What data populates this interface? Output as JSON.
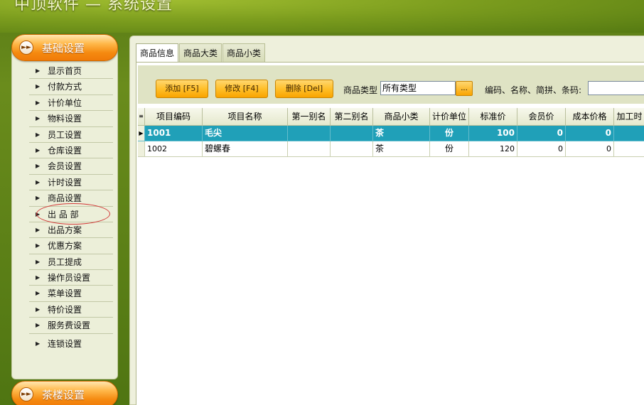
{
  "window": {
    "title": "中顶软件 — 系统设置"
  },
  "sidebar": {
    "group1": {
      "label": "基础设置"
    },
    "items": [
      {
        "label": "显示首页"
      },
      {
        "label": "付款方式"
      },
      {
        "label": "计价单位"
      },
      {
        "label": "物料设置"
      },
      {
        "label": "员工设置"
      },
      {
        "label": "仓库设置"
      },
      {
        "label": "会员设置"
      },
      {
        "label": "计时设置"
      },
      {
        "label": "商品设置"
      },
      {
        "label": "出 品 部"
      },
      {
        "label": "出品方案"
      },
      {
        "label": "优惠方案"
      },
      {
        "label": "员工提成"
      },
      {
        "label": "操作员设置"
      },
      {
        "label": "菜单设置"
      },
      {
        "label": "特价设置"
      },
      {
        "label": "服务费设置"
      },
      {
        "label": "连锁设置"
      }
    ],
    "group2": {
      "label": "茶楼设置"
    }
  },
  "main": {
    "tabs": [
      {
        "label": "商品信息"
      },
      {
        "label": "商品大类"
      },
      {
        "label": "商品小类"
      }
    ],
    "toolbar": {
      "add_label": "添加 [F5]",
      "edit_label": "修改 [F4]",
      "delete_label": "删除 [Del]",
      "type_label": "商品类型",
      "type_value": "所有类型",
      "browse_label": "...",
      "search_label": "编码、名称、简拼、条码:",
      "search_value": ""
    },
    "grid": {
      "columns": [
        "项目编码",
        "项目名称",
        "第一别名",
        "第二别名",
        "商品小类",
        "计价单位",
        "标准价",
        "会员价",
        "成本价格",
        "加工时"
      ],
      "rows": [
        {
          "code": "1001",
          "name": "毛尖",
          "alias1": "",
          "alias2": "",
          "subcat": "茶",
          "unit": "份",
          "price": "100",
          "member_price": "0",
          "cost": "0",
          "proc": ""
        },
        {
          "code": "1002",
          "name": "碧螺春",
          "alias1": "",
          "alias2": "",
          "subcat": "茶",
          "unit": "份",
          "price": "120",
          "member_price": "0",
          "cost": "0",
          "proc": ""
        }
      ]
    }
  },
  "colors": {
    "accent_orange": "#f58a10",
    "selected_row": "#20a0b8",
    "panel_bg": "#eef0dc",
    "background_green": "#5f8118",
    "highlight_circle": "#d23838"
  }
}
